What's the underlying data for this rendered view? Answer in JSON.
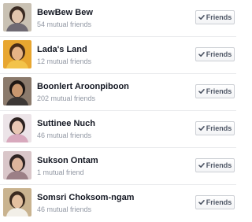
{
  "friends": [
    {
      "name": "BewBew Bew",
      "mutual": "54 mutual friends",
      "button": "Friends",
      "avatar_colors": {
        "bg": "#c9c1b3",
        "face": "#e2c5ad",
        "hair": "#3a2a22",
        "shirt": "#6f6a73"
      }
    },
    {
      "name": "Lada's Land",
      "mutual": "12 mutual friends",
      "button": "Friends",
      "avatar_colors": {
        "bg": "#e8a630",
        "face": "#e6b386",
        "hair": "#4a2d18",
        "shirt": "#f3c34a"
      }
    },
    {
      "name": "Boonlert Aroonpiboon",
      "mutual": "202 mutual friends",
      "button": "Friends",
      "avatar_colors": {
        "bg": "#8b7a6c",
        "face": "#c9976f",
        "hair": "#1e1714",
        "shirt": "#3c3735"
      }
    },
    {
      "name": "Suttinee Nuch",
      "mutual": "46 mutual friends",
      "button": "Friends",
      "avatar_colors": {
        "bg": "#ece4e8",
        "face": "#e9c7b4",
        "hair": "#2c2220",
        "shirt": "#d8a9bd"
      }
    },
    {
      "name": "Sukson Ontam",
      "mutual": "1 mutual friend",
      "button": "Friends",
      "avatar_colors": {
        "bg": "#d9c6c9",
        "face": "#dcb49c",
        "hair": "#2e2423",
        "shirt": "#9c7f86"
      }
    },
    {
      "name": "Somsri Choksom-ngam",
      "mutual": "46 mutual friends",
      "button": "Friends",
      "avatar_colors": {
        "bg": "#c9b38f",
        "face": "#e4c09f",
        "hair": "#3b2b1f",
        "shirt": "#f2efe8"
      }
    }
  ],
  "icons": {
    "check": "check-icon"
  },
  "colors": {
    "name": "#141823",
    "meta": "#9197a3",
    "button_text": "#4e5665",
    "button_border": "#cccfd4",
    "divider": "#e9eaed"
  }
}
